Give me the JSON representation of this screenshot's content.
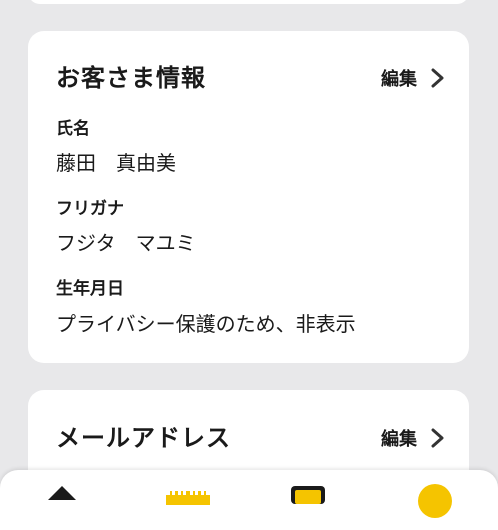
{
  "customer_info": {
    "title": "お客さま情報",
    "edit_label": "編集",
    "fields": [
      {
        "label": "氏名",
        "value": "藤田　真由美"
      },
      {
        "label": "フリガナ",
        "value": "フジタ　マユミ"
      },
      {
        "label": "生年月日",
        "value": "プライバシー保護のため、非表示"
      }
    ]
  },
  "mail_section": {
    "title": "メールアドレス",
    "edit_label": "編集"
  },
  "colors": {
    "accent_yellow": "#f5c400",
    "background": "#e8e8ea"
  },
  "tabbar": {
    "icons": [
      "home-icon",
      "barcode-icon",
      "card-icon",
      "coin-icon"
    ]
  }
}
